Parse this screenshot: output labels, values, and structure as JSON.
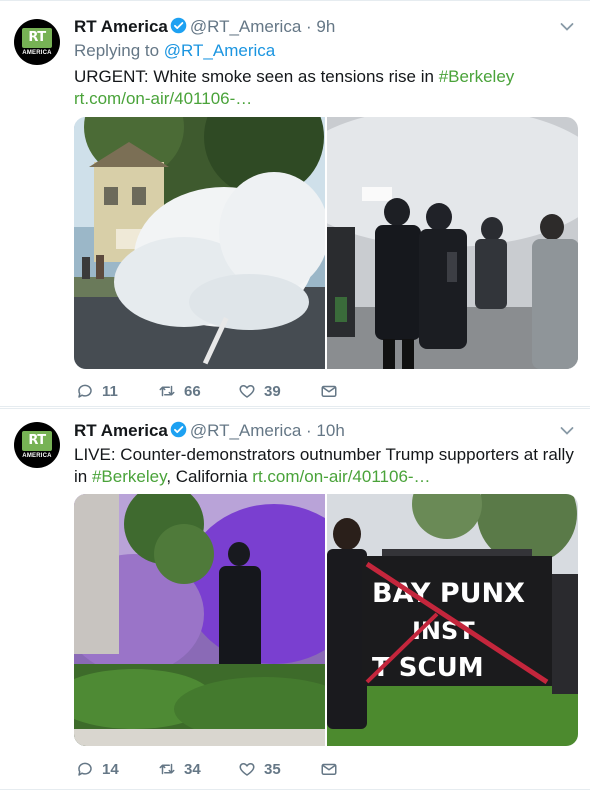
{
  "tweets": [
    {
      "author_name": "RT America",
      "handle": "@RT_America",
      "separator": "·",
      "time": "9h",
      "avatar_logo": "RT",
      "avatar_sub": "AMERICA",
      "replying_prefix": "Replying to",
      "replying_handle": "@RT_America",
      "text_before": "URGENT: White smoke seen as tensions rise in ",
      "hashtag": "#Berkeley",
      "url": "rt.com/on-air/401106-…",
      "counts": {
        "replies": "11",
        "retweets": "66",
        "likes": "39"
      },
      "photos": [
        "white-smoke-street-photo",
        "police-in-smoke-photo"
      ]
    },
    {
      "author_name": "RT America",
      "handle": "@RT_America",
      "separator": "·",
      "time": "10h",
      "avatar_logo": "RT",
      "avatar_sub": "AMERICA",
      "text_before": "LIVE: Counter-demonstrators outnumber Trump supporters at rally in ",
      "hashtag": "#Berkeley",
      "text_after": ", California ",
      "url": "rt.com/on-air/401106-…",
      "counts": {
        "replies": "14",
        "retweets": "34",
        "likes": "35"
      },
      "photos": [
        "purple-smoke-police-photo",
        "bay-punx-banner-photo"
      ],
      "banner_text": [
        "BAY PUNX",
        "INST",
        "T SCUM"
      ]
    }
  ],
  "colors": {
    "accent_link": "#1b95e0",
    "hashtag": "#4aa33a",
    "muted": "#657786",
    "rt_green": "#77b255"
  }
}
